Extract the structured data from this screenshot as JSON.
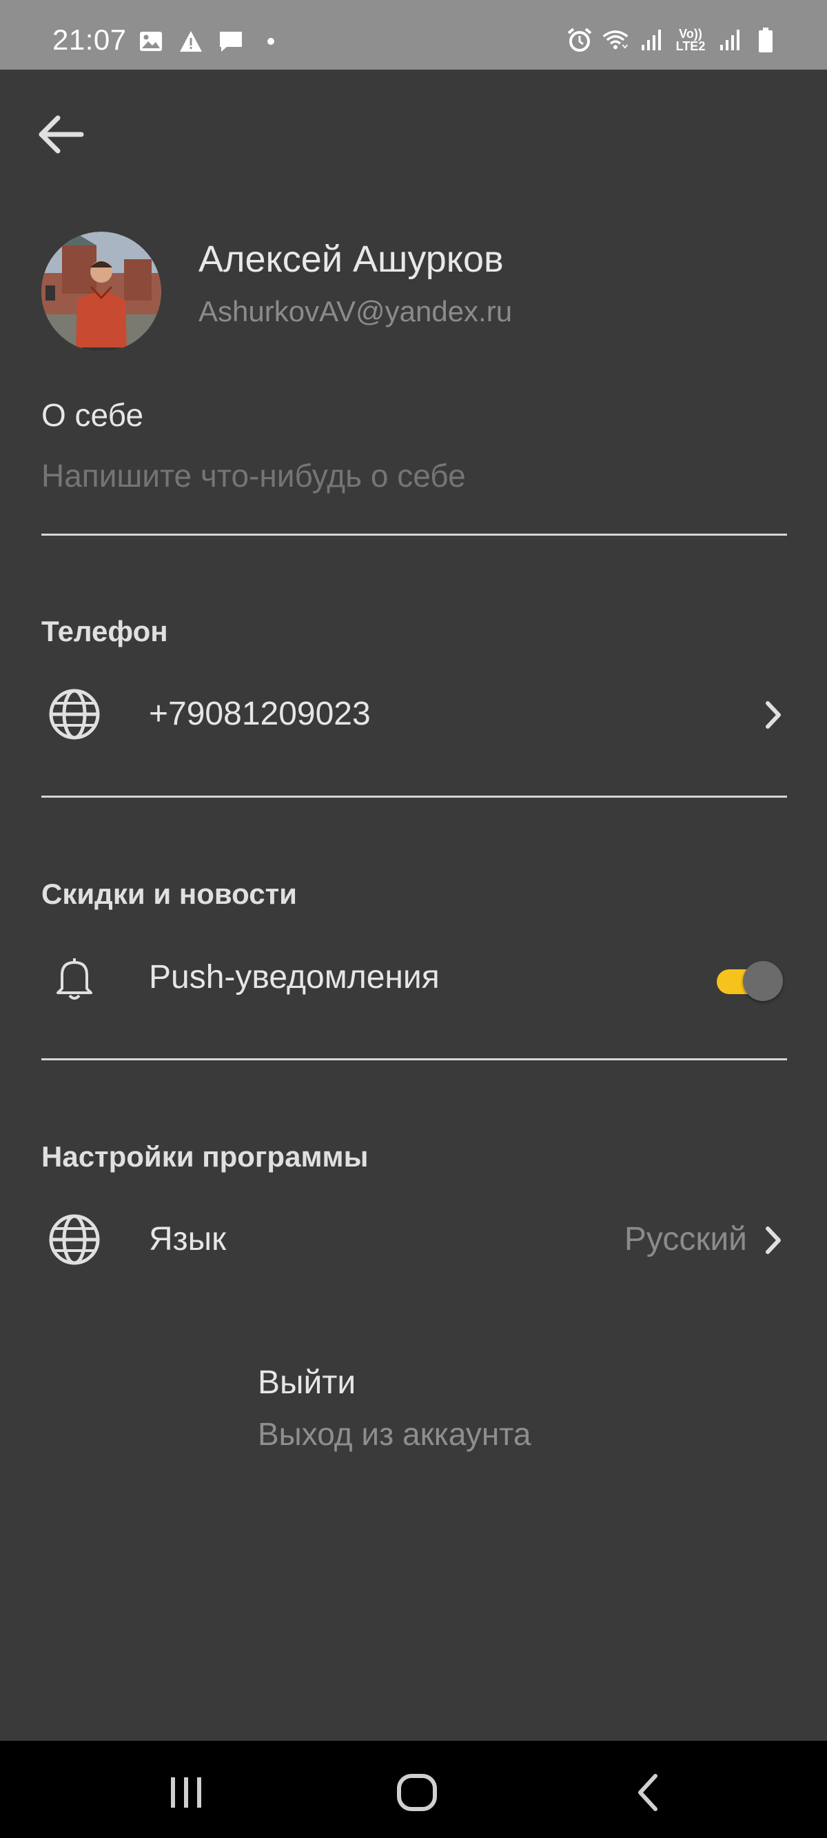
{
  "status_bar": {
    "time": "21:07",
    "left_icons": [
      "image-icon",
      "warning-icon",
      "message-icon",
      "dot-icon"
    ],
    "right_icons": [
      "alarm-icon",
      "wifi-icon",
      "signal-icon",
      "volte-lte2-icon",
      "signal-icon",
      "battery-icon"
    ],
    "volte_label_top": "Vo))",
    "volte_label_bottom": "LTE2"
  },
  "header": {
    "back_icon": "arrow-left-icon"
  },
  "profile": {
    "name": "Алексей Ашурков",
    "email": "AshurkovAV@yandex.ru"
  },
  "about": {
    "label": "О себе",
    "placeholder": "Напишите что-нибудь о себе",
    "value": ""
  },
  "sections": {
    "phone": {
      "title": "Телефон",
      "icon": "globe-icon",
      "value": "+79081209023"
    },
    "news": {
      "title": "Скидки и новости",
      "icon": "bell-icon",
      "label": "Push-уведомления",
      "toggle_on": true,
      "accent": "#f6c21c"
    },
    "app_settings": {
      "title": "Настройки программы",
      "icon": "globe-icon",
      "label": "Язык",
      "value": "Русский"
    }
  },
  "logout": {
    "title": "Выйти",
    "subtitle": "Выход из аккаунта"
  },
  "nav_bar": {
    "buttons": [
      "recent-apps-icon",
      "home-icon",
      "back-icon"
    ]
  },
  "colors": {
    "background": "#3a3a3a",
    "status_bar": "#8f8f8f",
    "nav_bar": "#000000",
    "accent": "#f6c21c"
  }
}
